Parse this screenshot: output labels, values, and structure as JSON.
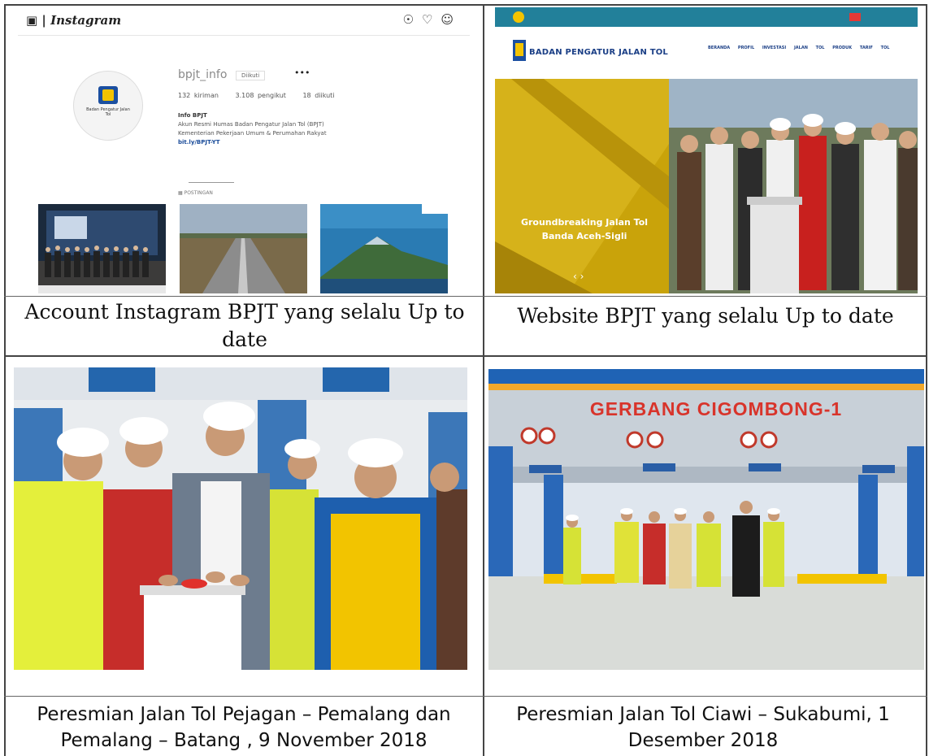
{
  "top_left": {
    "instagram": {
      "brand": "Instagram",
      "username": "bpjt_info",
      "follow_button": "Diikuti",
      "more": "•••",
      "stats": {
        "posts": "132 kiriman",
        "followers": "3.108 pengikut",
        "following": "18 diikuti"
      },
      "bio_title": "Info BPJT",
      "bio_line1": "Akun Resmi Humas Badan Pengatur Jalan Tol (BPJT)",
      "bio_line2": "Kementerian Pekerjaan Umum & Perumahan Rakyat",
      "bio_link": "bit.ly/BPJT-YT",
      "tab_posts": "POSTINGAN",
      "avatar_text": "Badan Pengatur Jalan Tol"
    },
    "caption": "Account Instagram BPJT yang selalu Up to date"
  },
  "top_right": {
    "website": {
      "org_name": "BADAN PENGATUR JALAN TOL",
      "nav": [
        "BERANDA",
        "PROFIL",
        "INVESTASI",
        "JALAN TOL",
        "PRODUK",
        "TARIF TOL"
      ],
      "hero_text": "Groundbreaking Jalan Tol Banda Aceh-Sigli"
    },
    "caption": "Website BPJT yang selalu Up to date"
  },
  "bottom_left": {
    "caption": "Peresmian Jalan Tol Pejagan – Pemalang dan Pemalang – Batang , 9 November 2018"
  },
  "bottom_right": {
    "gate_sign": "GERBANG CIGOMBONG-1",
    "caption": "Peresmian Jalan Tol Ciawi – Sukabumi, 1 Desember 2018"
  },
  "colors": {
    "border": "#444444",
    "bpjt_blue": "#1b4fa0",
    "bpjt_yellow": "#f3c300",
    "web_topbar": "#22809a",
    "gate_red": "#d8342b"
  }
}
